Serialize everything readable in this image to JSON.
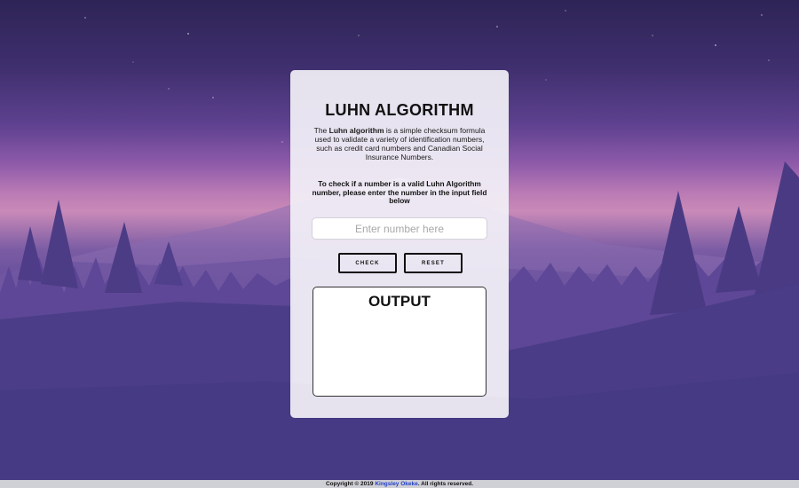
{
  "page": {
    "title": "LUHN ALGORITHM",
    "description": {
      "prefix": "The ",
      "bold": "Luhn algorithm",
      "suffix": " is a simple checksum formula used to validate a variety of identification numbers, such as credit card numbers and Canadian Social Insurance Numbers."
    },
    "instruction": "To check if a number is a valid Luhn Algorithm number, please enter the number in the input field below",
    "input": {
      "placeholder": "Enter number here",
      "value": ""
    },
    "buttons": {
      "check": "CHECK",
      "reset": "RESET"
    },
    "output": {
      "heading": "OUTPUT"
    }
  },
  "footer": {
    "prefix": "Copyright © 2019 ",
    "author": "Kingsley Okeke",
    "suffix": ". All rights reserved."
  },
  "colors": {
    "sky_top": "#2e2456",
    "horizon_glow": "#c98ab8",
    "ground": "#453a83",
    "card_bg": "#f2f0f8",
    "link": "#1d3ec8"
  }
}
